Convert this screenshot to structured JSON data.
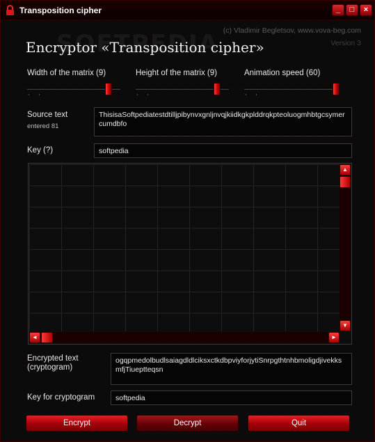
{
  "window": {
    "title": "Transposition cipher",
    "controls": [
      "_",
      "□",
      "×"
    ]
  },
  "header": {
    "copyright": "(c) Vladimir Begletsov, www.vova-beg.com",
    "version": "Version 3",
    "watermark": "SOFTPEDIA",
    "title": "Encryptor «Transposition cipher»"
  },
  "sliders": [
    {
      "label": "Width of the matrix (9)",
      "level": 0.9
    },
    {
      "label": "Height of the matrix (9)",
      "level": 0.9
    },
    {
      "label": "Animation speed (60)",
      "level": 0.95
    }
  ],
  "source": {
    "label": "Source text",
    "count_label": "entered 81",
    "value": "ThisisaSoftpediatestdtilljpibynvxgnljnvqjkiidkgkplddrqkpteoluogmhbtgcsymercumdbfo"
  },
  "key": {
    "label": "Key (?)",
    "value": "softpedia"
  },
  "matrix": {
    "vscroll_up": "▲",
    "vscroll_down": "▼",
    "hscroll_left": "◄",
    "hscroll_right": "►"
  },
  "encrypted": {
    "label": "Encrypted text (cryptogram)",
    "value": "ogqpmedolbudlsaiagdldlciksxctkdbpviyforjytiSnrpgthtnhbmoligdjivekksmfjTiueptteqsn"
  },
  "crypto_key": {
    "label": "Key for cryptogram",
    "value": "softpedia"
  },
  "buttons": {
    "encrypt": "Encrypt",
    "decrypt": "Decrypt",
    "quit": "Quit"
  },
  "colors": {
    "accent": "#d4141c",
    "background": "#0b0b0b"
  }
}
